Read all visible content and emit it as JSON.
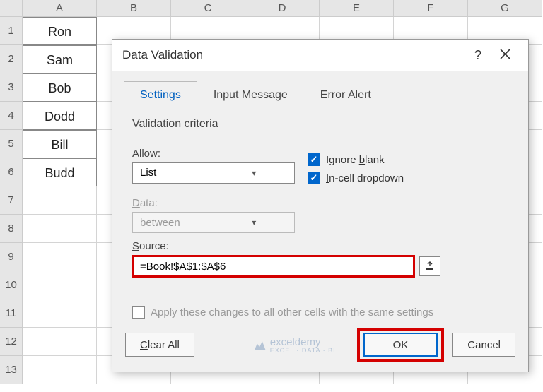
{
  "sheet": {
    "columns": [
      "A",
      "B",
      "C",
      "D",
      "E",
      "F",
      "G"
    ],
    "row_headers": [
      "1",
      "2",
      "3",
      "4",
      "5",
      "6",
      "7",
      "8",
      "9",
      "10",
      "11",
      "12",
      "13"
    ],
    "colA": [
      "Ron",
      "Sam",
      "Bob",
      "Dodd",
      "Bill",
      "Budd"
    ]
  },
  "dialog": {
    "title": "Data Validation",
    "tabs": {
      "settings": "Settings",
      "input_message": "Input Message",
      "error_alert": "Error Alert"
    },
    "criteria_label": "Validation criteria",
    "allow_label": "Allow:",
    "allow_value": "List",
    "data_label": "Data:",
    "data_value": "between",
    "ignore_blank": "Ignore blank",
    "incell_dropdown": "In-cell dropdown",
    "source_label": "Source:",
    "source_value": "=Book!$A$1:$A$6",
    "apply_all": "Apply these changes to all other cells with the same settings",
    "clear_all": "Clear All",
    "ok": "OK",
    "cancel": "Cancel",
    "watermark": "exceldemy",
    "watermark_sub": "EXCEL · DATA · BI"
  }
}
